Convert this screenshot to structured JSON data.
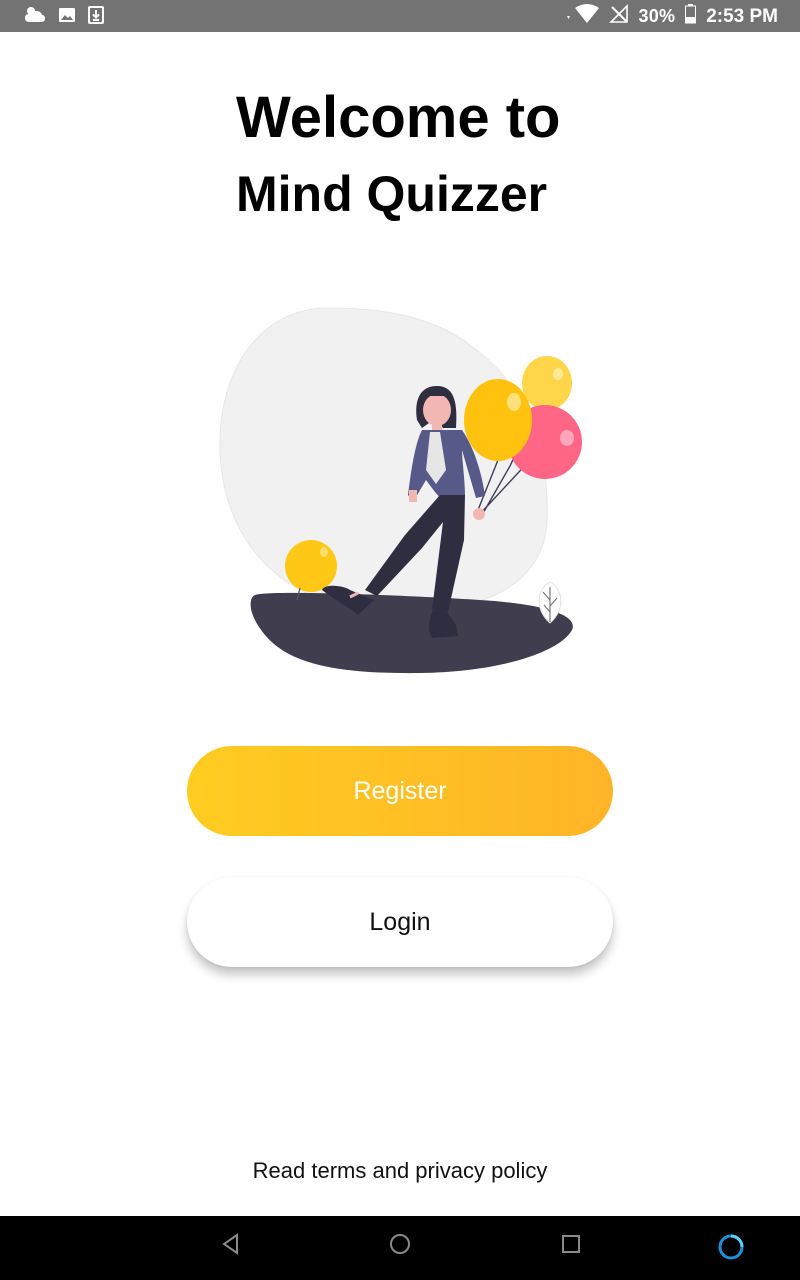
{
  "status_bar": {
    "battery": "30%",
    "time": "2:53 PM"
  },
  "welcome": {
    "line1": "Welcome to",
    "line2": "Mind Quizzer"
  },
  "illustration": {
    "name": "woman-with-balloons-illustration"
  },
  "buttons": {
    "register": "Register",
    "login": "Login"
  },
  "footer": {
    "terms": "Read terms and privacy policy"
  },
  "colors": {
    "register_start": "#FFCC21",
    "register_end": "#FFB427",
    "status_bar": "#737373",
    "nav_bar": "#000000"
  },
  "nav": {
    "icons": [
      "back-icon",
      "home-icon",
      "recents-icon",
      "assistant-icon"
    ]
  }
}
